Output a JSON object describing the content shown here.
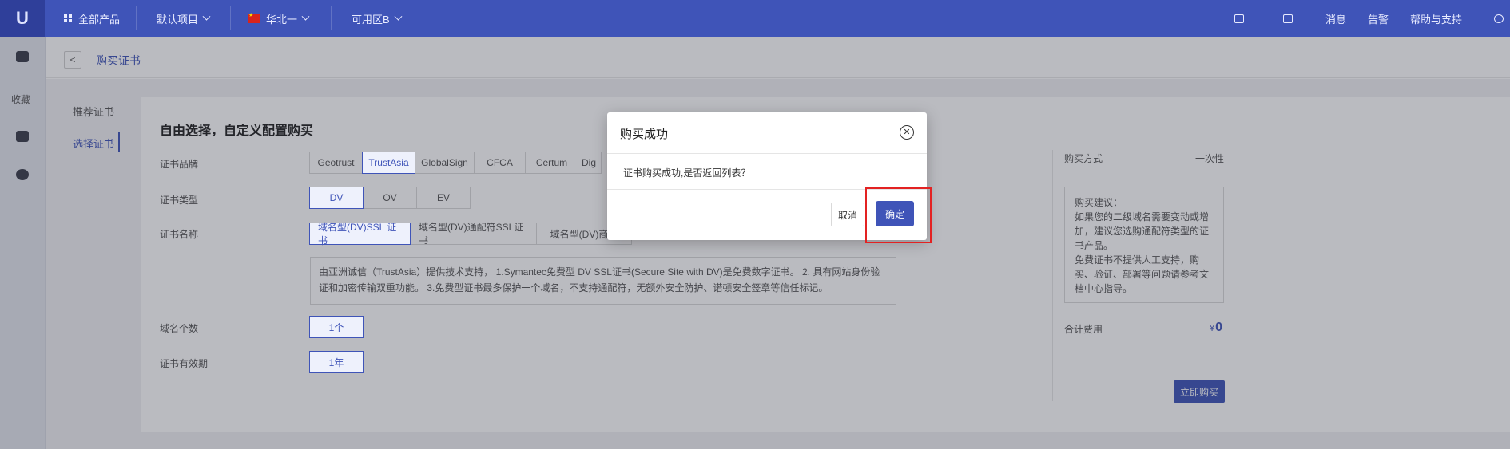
{
  "topbar": {
    "logo": "U",
    "all_products": "全部产品",
    "project": "默认项目",
    "region": "华北一",
    "zone": "可用区B",
    "messages": "消息",
    "alerts": "告警",
    "help": "帮助与支持"
  },
  "sidebar": {
    "favorites": "收藏"
  },
  "breadcrumb": {
    "back": "<",
    "title": "购买证书"
  },
  "subtabs": {
    "recommended": "推荐证书",
    "select": "选择证书"
  },
  "form": {
    "title": "自由选择，自定义配置购买",
    "brand_label": "证书品牌",
    "brands": [
      "Geotrust",
      "TrustAsia",
      "GlobalSign",
      "CFCA",
      "Certum",
      "Dig"
    ],
    "brand_selected": "TrustAsia",
    "type_label": "证书类型",
    "types": [
      "DV",
      "OV",
      "EV"
    ],
    "type_selected": "DV",
    "name_label": "证书名称",
    "names": [
      "域名型(DV)SSL 证书",
      "域名型(DV)通配符SSL证书",
      "域名型(DV)商业"
    ],
    "name_selected": "域名型(DV)SSL 证书",
    "description": "由亚洲诚信（TrustAsia）提供技术支持， 1.Symantec免费型 DV SSL证书(Secure Site with DV)是免费数字证书。 2. 具有网站身份验证和加密传输双重功能。 3.免费型证书最多保护一个域名，不支持通配符，无额外安全防护、诺顿安全签章等信任标记。",
    "domain_count_label": "域名个数",
    "domain_count": "1个",
    "validity_label": "证书有效期",
    "validity": "1年"
  },
  "purchase": {
    "method_label": "购买方式",
    "method_value": "一次性",
    "advice": "购买建议：\n如果您的二级域名需要变动或增加，建议您选购通配符类型的证书产品。\n免费证书不提供人工支持，购买、验证、部署等问题请参考文档中心指导。",
    "total_label": "合计费用",
    "currency": "¥",
    "total_value": "0",
    "buy_button": "立即购买"
  },
  "modal": {
    "title": "购买成功",
    "close": "✕",
    "message": "证书购买成功,是否返回列表？",
    "cancel": "取消",
    "ok": "确定"
  },
  "colors": {
    "primary": "#3f54b8",
    "highlight": "#e32222"
  }
}
